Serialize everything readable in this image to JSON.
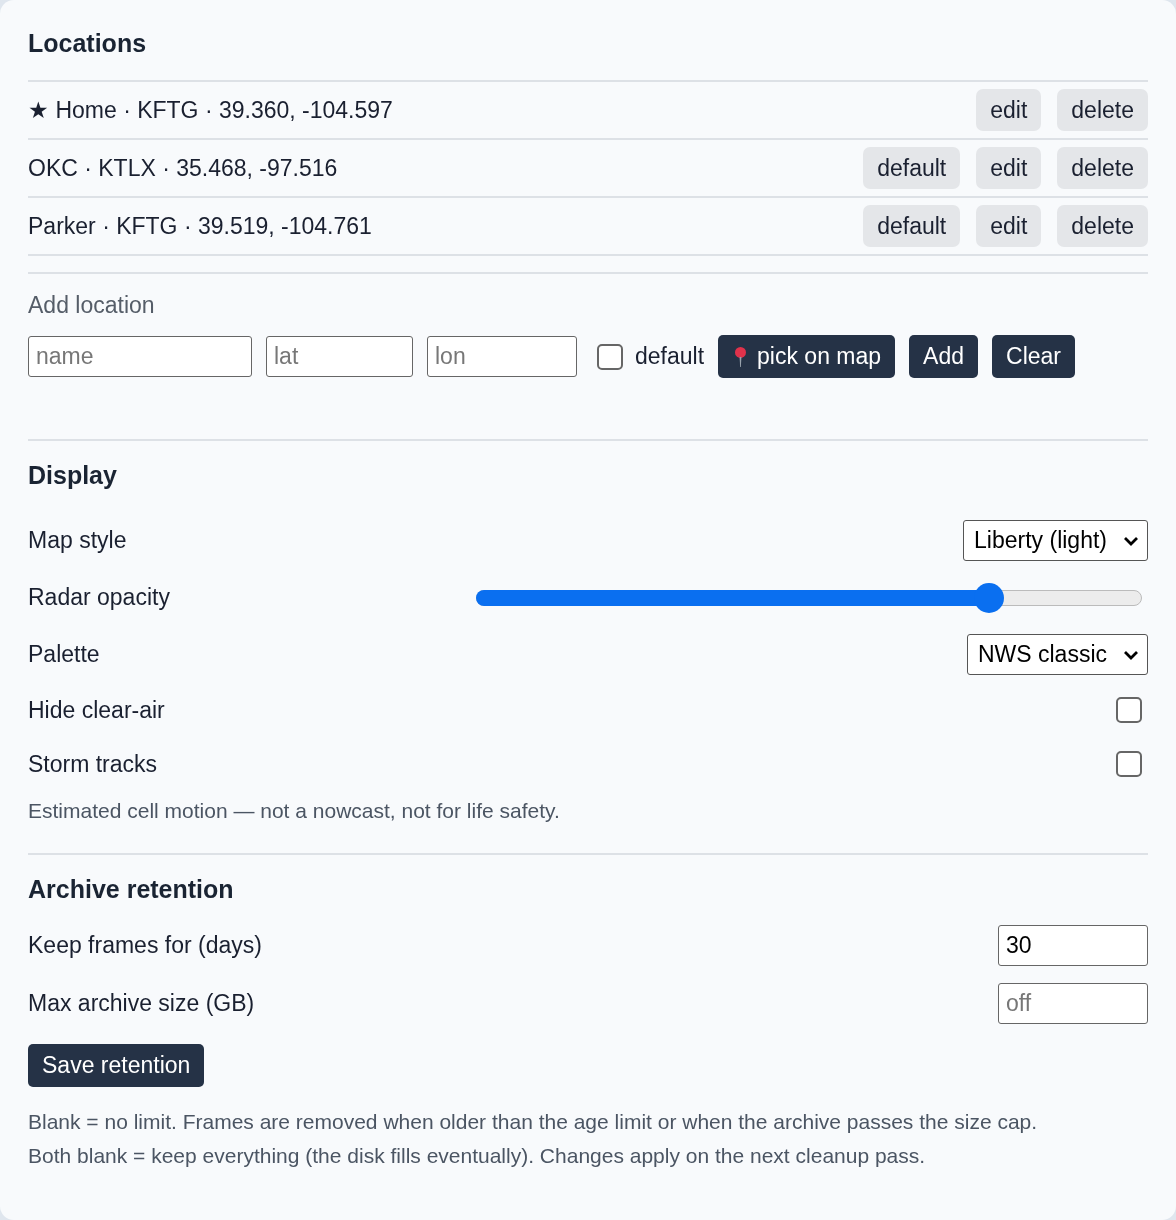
{
  "locations": {
    "title": "Locations",
    "items": [
      {
        "text": "★ Home · KFTG · 39.360, -104.597",
        "actions": [
          "edit",
          "delete"
        ]
      },
      {
        "text": "OKC · KTLX · 35.468, -97.516",
        "actions": [
          "default",
          "edit",
          "delete"
        ]
      },
      {
        "text": "Parker · KFTG · 39.519, -104.761",
        "actions": [
          "default",
          "edit",
          "delete"
        ]
      }
    ],
    "add": {
      "label": "Add location",
      "fields": [
        {
          "placeholder": "name"
        },
        {
          "placeholder": "lat"
        },
        {
          "placeholder": "lon"
        }
      ],
      "default_checkbox": {
        "label": "default",
        "checked": false
      },
      "pick_button": "pick on map",
      "add_button": "Add",
      "clear_button": "Clear"
    }
  },
  "display": {
    "title": "Display",
    "settings": [
      {
        "kind": "select",
        "label": "Map style",
        "value": "Liberty (light)"
      },
      {
        "kind": "slider",
        "label": "Radar opacity",
        "level": 0.77
      },
      {
        "kind": "select",
        "label": "Palette",
        "value": "NWS classic"
      },
      {
        "kind": "checkbox",
        "label": "Hide clear-air",
        "checked": false
      },
      {
        "kind": "checkbox",
        "label": "Storm tracks",
        "checked": false
      }
    ],
    "note": "Estimated cell motion — not a nowcast, not for life safety."
  },
  "retention": {
    "title": "Archive retention",
    "fields": [
      {
        "label": "Keep frames for (days)",
        "value": "30"
      },
      {
        "label": "Max archive size (GB)",
        "placeholder": "off"
      }
    ],
    "save_button": "Save retention",
    "notes": [
      "Blank = no limit. Frames are removed when older than the age limit or when the archive passes the size cap.",
      "Both blank = keep everything (the disk fills eventually). Changes apply on the next cleanup pass."
    ]
  }
}
